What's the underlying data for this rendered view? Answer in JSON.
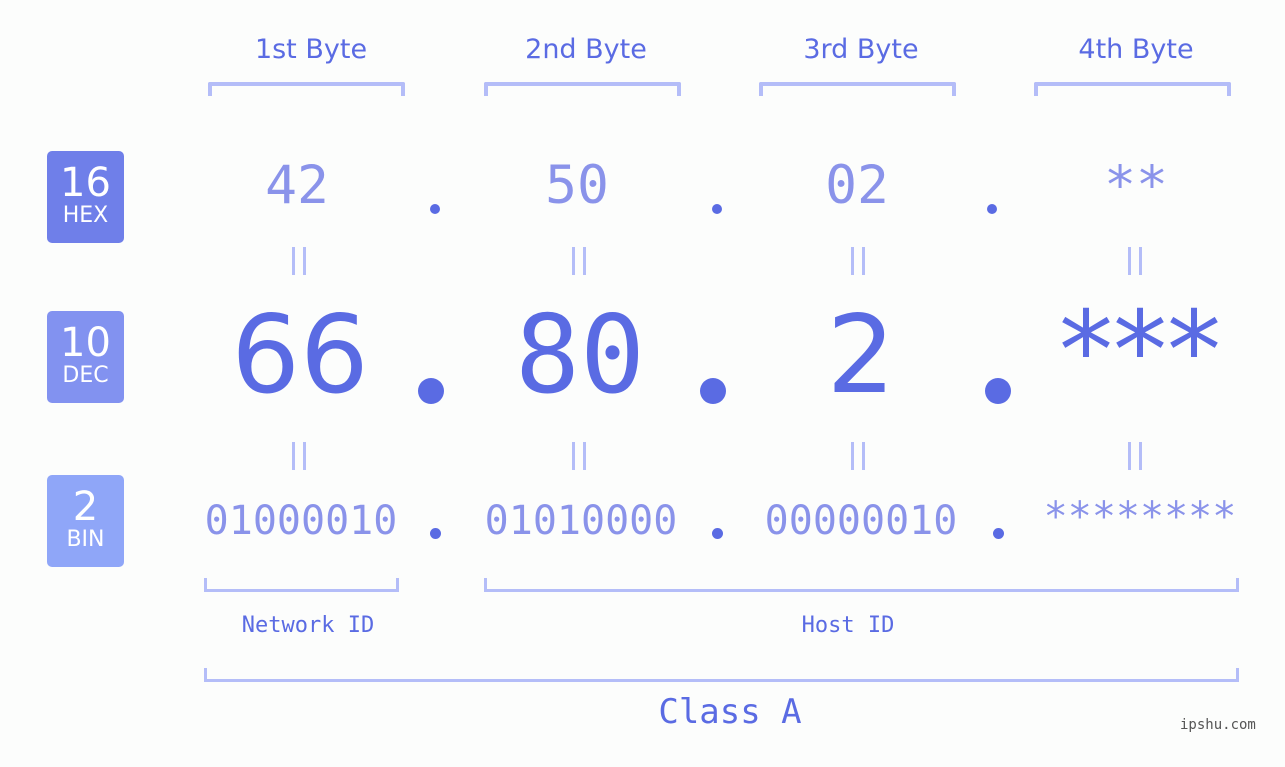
{
  "headers": [
    "1st Byte",
    "2nd Byte",
    "3rd Byte",
    "4th Byte"
  ],
  "badges": [
    {
      "number": "16",
      "label": "HEX",
      "color": "#6f7fe9"
    },
    {
      "number": "10",
      "label": "DEC",
      "color": "#8292f0"
    },
    {
      "number": "2",
      "label": "BIN",
      "color": "#8fa6f8"
    }
  ],
  "hex": [
    "42",
    "50",
    "02",
    "**"
  ],
  "dec": [
    "66",
    "80",
    "2",
    "***"
  ],
  "bin": [
    "01000010",
    "01010000",
    "00000010",
    "********"
  ],
  "separator": ".",
  "network_id_label": "Network ID",
  "host_id_label": "Host ID",
  "class_label": "Class A",
  "watermark": "ipshu.com",
  "colors": {
    "accent": "#5a6be3",
    "light_accent": "#8a93ea",
    "bracket": "#b4bdf8",
    "background": "#fcfdfc"
  }
}
